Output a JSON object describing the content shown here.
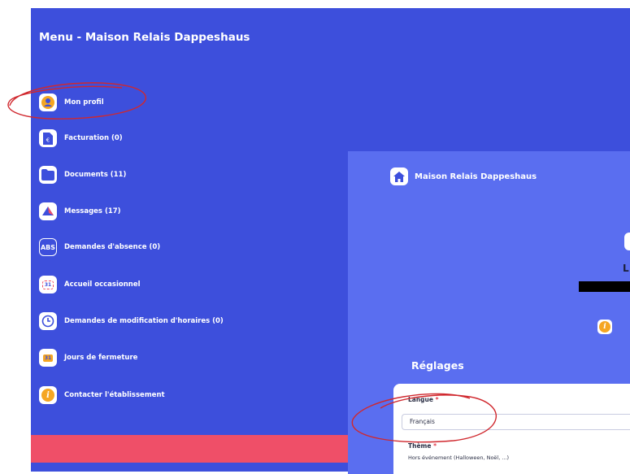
{
  "menu": {
    "title": "Menu - Maison Relais Dappeshaus",
    "items": [
      {
        "label": "Mon profil",
        "icon": "profile-icon"
      },
      {
        "label": "Facturation (0)",
        "icon": "invoice-icon"
      },
      {
        "label": "Documents (11)",
        "icon": "folder-icon"
      },
      {
        "label": "Messages (17)",
        "icon": "messages-icon"
      },
      {
        "label": "Demandes d'absence (0)",
        "icon": "abs-icon",
        "icon_text": "ABS"
      },
      {
        "label": "Accueil occasionnel",
        "icon": "calendar-icon",
        "icon_text": "31"
      },
      {
        "label": "Demandes de modification d'horaires (0)",
        "icon": "clock-icon"
      },
      {
        "label": "Jours de fermeture",
        "icon": "closed-days-icon",
        "icon_text": "31"
      },
      {
        "label": "Contacter l'établissement",
        "icon": "info-icon",
        "icon_text": "i"
      }
    ]
  },
  "right_panel": {
    "title": "Maison Relais Dappeshaus",
    "partial_letter": "L",
    "settings_title": "Réglages",
    "language": {
      "label": "Langue",
      "required_mark": "*",
      "value": "Français"
    },
    "theme": {
      "label": "Thème",
      "required_mark": "*",
      "value": "Hors événement (Halloween, Noël, ...)"
    }
  },
  "colors": {
    "menu_bg": "#3d4fdc",
    "panel_bg": "#5a6ef0",
    "logout_bar": "#ef4f68",
    "annotation": "#d0282e",
    "profile_orange": "#f5a623"
  }
}
